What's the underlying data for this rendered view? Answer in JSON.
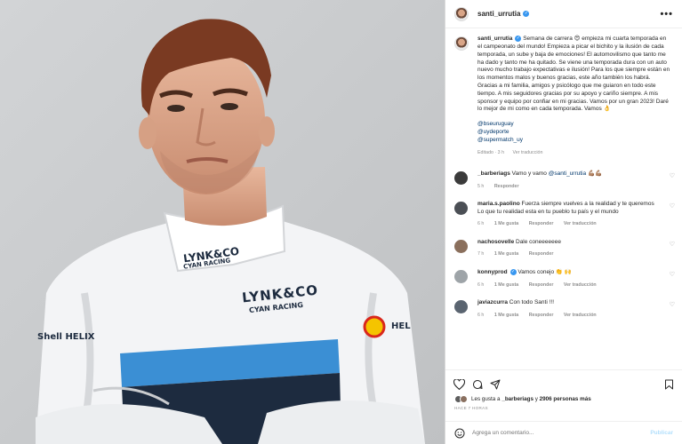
{
  "post": {
    "username": "santi_urrutia",
    "more_label": "•••"
  },
  "caption": {
    "username": "santi_urrutia",
    "text": "Semana de carrera 😍 empieza mi cuarta temporada en el campeonato del mundo! Empieza a picar el bichito y la ilusión de cada temporada, un sube y baja de emociones! El automovilismo que tanto me ha dado y tanto me ha quitado. Se viene una temporada dura con un auto nuevo mucho trabajo expectativas e ilusión! Para los que siempre están en los momentos malos y buenos gracias, este año también los habrá. Gracias a mi familia, amigos y psicólogo que me guiaron en todo este tiempo. A mis seguidores gracias por su apoyo y cariño siempre. A mis sponsor y equipo por confiar en mi gracias. Vamos por un gran 2023! Daré lo mejor de mi como en cada temporada. Vamos 👌",
    "tags": [
      "@bseuruguay",
      "@uydeporte",
      "@supermatch_uy"
    ],
    "meta_edited": "Editado · 3 h",
    "meta_translate": "Ver traducción"
  },
  "comments": [
    {
      "username": "_barberiags",
      "text": "Vamo y vamo",
      "mention": "@santi_urrutia",
      "emoji": "💪🏽💪🏽",
      "time": "5 h",
      "actions": [
        "Responder"
      ]
    },
    {
      "username": "maria.s.paolino",
      "text": "Fuerza siempre vuelves a la realidad y te queremos Lo que tu realidad esta en tu pueblo tu país y el mundo",
      "time": "6 h",
      "actions": [
        "1 Me gusta",
        "Responder",
        "Ver traducción"
      ]
    },
    {
      "username": "nachosovelle",
      "text": "Dale coneeeeeee",
      "time": "7 h",
      "actions": [
        "1 Me gusta",
        "Responder"
      ]
    },
    {
      "username": "konnyprod",
      "text": "Vamos conejo 👏 🙌",
      "time": "6 h",
      "actions": [
        "1 Me gusta",
        "Responder",
        "Ver traducción"
      ]
    },
    {
      "username": "javiazcurra",
      "text": "Con todo Santi !!!",
      "time": "6 h",
      "actions": [
        "1 Me gusta",
        "Responder",
        "Ver traducción"
      ]
    }
  ],
  "likes": {
    "prefix": "Les gusta a",
    "user": "_barberiags",
    "middle": "y",
    "count": "2906 personas más"
  },
  "posted_ago": "HACE 7 HORAS",
  "add_comment": {
    "placeholder": "Agrega un comentario...",
    "publish_label": "Publicar"
  },
  "photo": {
    "suit_brand_chest": "LYNK&CO",
    "suit_brand_sub": "CYAN RACING",
    "collar_brand": "LYNK&CO",
    "collar_sub": "CYAN RACING",
    "sponsor_left": "Shell HELIX",
    "sponsor_right": "HEL"
  },
  "colors": {
    "accent_blue": "#3897f0",
    "link": "#00376b",
    "suit_blue": "#3b8fd4",
    "suit_navy": "#1d2b3f"
  }
}
